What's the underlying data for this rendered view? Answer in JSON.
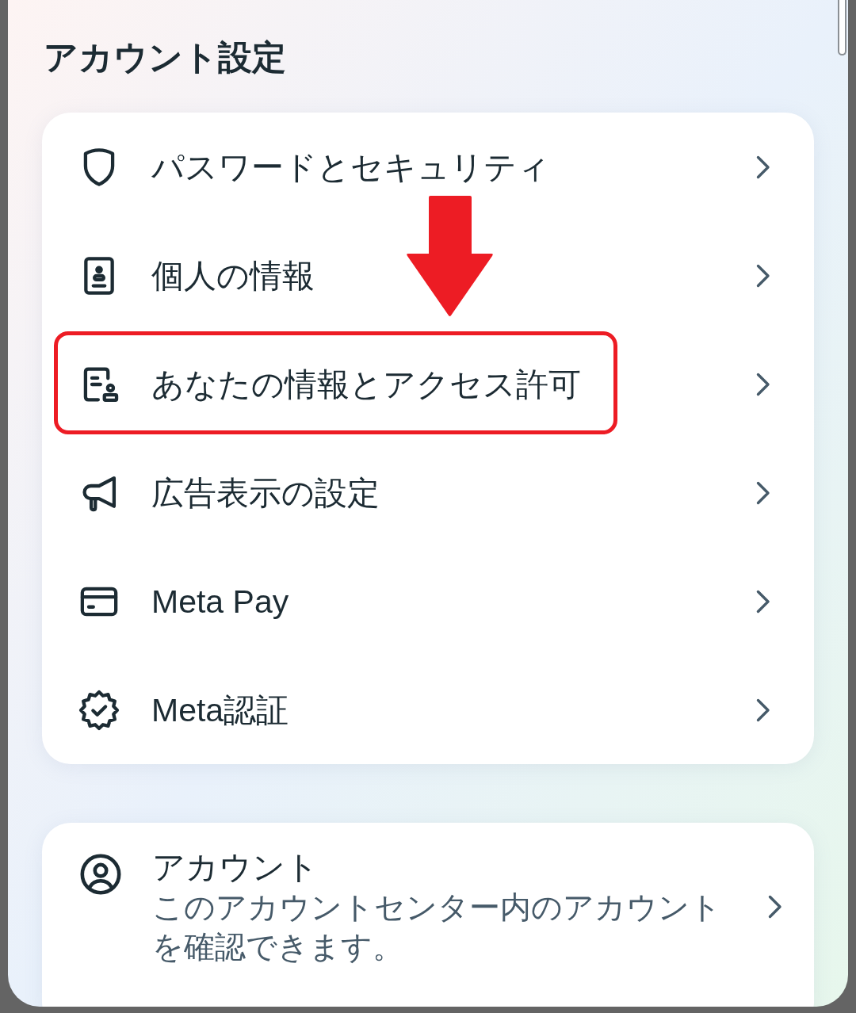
{
  "title": "アカウント設定",
  "settings_card": {
    "items": [
      {
        "label": "パスワードとセキュリティ",
        "highlighted": false
      },
      {
        "label": "個人の情報",
        "highlighted": false
      },
      {
        "label": "あなたの情報とアクセス許可",
        "highlighted": true
      },
      {
        "label": "広告表示の設定",
        "highlighted": false
      },
      {
        "label": "Meta Pay",
        "highlighted": false
      },
      {
        "label": "Meta認証",
        "highlighted": false
      }
    ]
  },
  "account_card": {
    "title": "アカウント",
    "description": "このアカウントセンター内のアカウントを確認できます。"
  }
}
